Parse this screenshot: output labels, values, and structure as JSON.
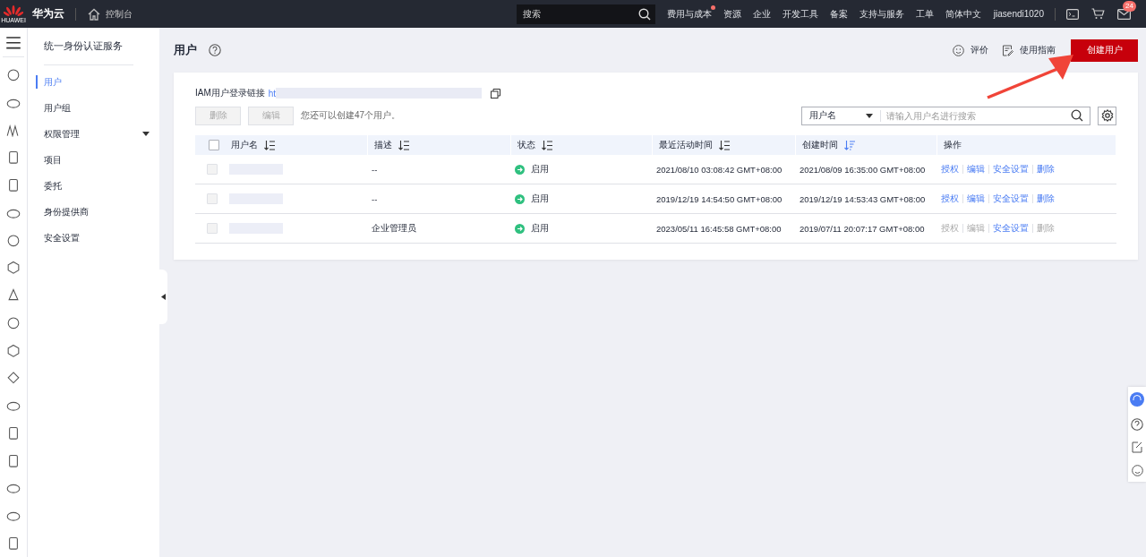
{
  "topbar": {
    "brand": "华为云",
    "logo_caption": "HUAWEI",
    "console": "控制台",
    "search": {
      "placeholder": "搜索"
    },
    "nav": [
      {
        "label": "费用与成本",
        "dot": true
      },
      {
        "label": "资源",
        "dot": false
      },
      {
        "label": "企业",
        "dot": false
      },
      {
        "label": "开发工具",
        "dot": false
      },
      {
        "label": "备案",
        "dot": false
      },
      {
        "label": "支持与服务",
        "dot": false
      },
      {
        "label": "工单",
        "dot": false
      },
      {
        "label": "简体中文",
        "dot": false
      }
    ],
    "user": "jiasendi1020",
    "mail_badge": "24"
  },
  "sidebar": {
    "title": "统一身份认证服务",
    "items": [
      {
        "label": "用户",
        "selected": true,
        "expandable": false
      },
      {
        "label": "用户组",
        "selected": false,
        "expandable": false
      },
      {
        "label": "权限管理",
        "selected": false,
        "expandable": true
      },
      {
        "label": "项目",
        "selected": false,
        "expandable": false
      },
      {
        "label": "委托",
        "selected": false,
        "expandable": false
      },
      {
        "label": "身份提供商",
        "selected": false,
        "expandable": false
      },
      {
        "label": "安全设置",
        "selected": false,
        "expandable": false
      }
    ]
  },
  "header": {
    "title": "用户",
    "rate": "评价",
    "guide": "使用指南",
    "create_button": "创建用户"
  },
  "login_link": {
    "label": "IAM用户登录链接",
    "link": "ht"
  },
  "toolbar": {
    "buttons": [
      {
        "label": "删除",
        "disabled": true
      },
      {
        "label": "编辑",
        "disabled": true
      }
    ],
    "hint": "您还可以创建47个用户。",
    "filter": "用户名",
    "search": {
      "placeholder": "请输入用户名进行搜索"
    }
  },
  "table": {
    "all_checked": false,
    "columns": [
      {
        "label": "用户名",
        "sortable": true,
        "sorted": false
      },
      {
        "label": "描述",
        "sortable": true,
        "sorted": false
      },
      {
        "label": "状态",
        "sortable": true,
        "sorted": false
      },
      {
        "label": "最近活动时间",
        "sortable": true,
        "sorted": false
      },
      {
        "label": "创建时间",
        "sortable": true,
        "sorted": true
      },
      {
        "label": "操作",
        "sortable": false
      }
    ],
    "rows": [
      {
        "checked": false,
        "description": "--",
        "status": "启用",
        "last_active": "2021/08/10 03:08:42 GMT+08:00",
        "created": "2021/08/09 16:35:00 GMT+08:00",
        "actions": [
          {
            "label": "授权",
            "disabled": false
          },
          {
            "label": "编辑",
            "disabled": false
          },
          {
            "label": "安全设置",
            "disabled": false
          },
          {
            "label": "删除",
            "disabled": false
          }
        ]
      },
      {
        "checked": false,
        "description": "--",
        "status": "启用",
        "last_active": "2019/12/19 14:54:50 GMT+08:00",
        "created": "2019/12/19 14:53:43 GMT+08:00",
        "actions": [
          {
            "label": "授权",
            "disabled": false
          },
          {
            "label": "编辑",
            "disabled": false
          },
          {
            "label": "安全设置",
            "disabled": false
          },
          {
            "label": "删除",
            "disabled": false
          }
        ]
      },
      {
        "checked": false,
        "description": "企业管理员",
        "status": "启用",
        "last_active": "2023/05/11 16:45:58 GMT+08:00",
        "created": "2019/07/11 20:07:17 GMT+08:00",
        "actions": [
          {
            "label": "授权",
            "disabled": true
          },
          {
            "label": "编辑",
            "disabled": true
          },
          {
            "label": "安全设置",
            "disabled": false
          },
          {
            "label": "删除",
            "disabled": true
          }
        ]
      }
    ]
  }
}
